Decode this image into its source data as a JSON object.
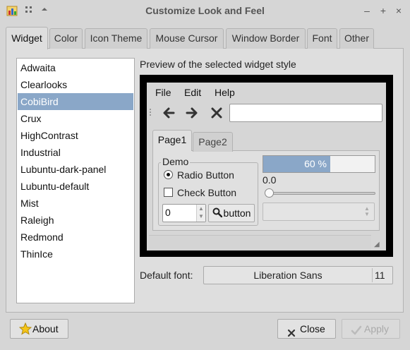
{
  "window": {
    "title": "Customize Look and Feel",
    "title_icons": {
      "app": "palette-icon",
      "menu": "dotted-grid-icon",
      "shade": "triangle-up-icon"
    },
    "controls": {
      "minimize": "–",
      "maximize": "+",
      "close": "×"
    }
  },
  "tabs": [
    {
      "label": "Widget",
      "active": true
    },
    {
      "label": "Color"
    },
    {
      "label": "Icon Theme"
    },
    {
      "label": "Mouse Cursor"
    },
    {
      "label": "Window Border"
    },
    {
      "label": "Font"
    },
    {
      "label": "Other"
    }
  ],
  "themes": {
    "items": [
      "Adwaita",
      "Clearlooks",
      "CobiBird",
      "Crux",
      "HighContrast",
      "Industrial",
      "Lubuntu-dark-panel",
      "Lubuntu-default",
      "Mist",
      "Raleigh",
      "Redmond",
      "ThinIce"
    ],
    "selected": "CobiBird"
  },
  "preview": {
    "label": "Preview of the selected widget style",
    "menu": [
      "File",
      "Edit",
      "Help"
    ],
    "toolbar_icons": [
      "back-arrow-icon",
      "forward-arrow-icon",
      "stop-icon"
    ],
    "url_value": "",
    "tabs": [
      "Page1",
      "Page2"
    ],
    "demo": {
      "frame_label": "Demo",
      "radio_label": "Radio Button",
      "check_label": "Check Button",
      "spin_value": "0",
      "button_label": "button",
      "button_icon": "search-icon"
    },
    "progress": {
      "fraction": 0.6,
      "text": "60 %"
    },
    "scale": {
      "value": "0.0",
      "fraction": 0.0
    },
    "combo_value": ""
  },
  "font": {
    "label": "Default font:",
    "name": "Liberation Sans",
    "size": "11"
  },
  "buttons": {
    "about": "About",
    "close": "Close",
    "apply": "Apply"
  },
  "colors": {
    "selection": "#8aa7c8",
    "window_bg": "#d6d6d6"
  }
}
